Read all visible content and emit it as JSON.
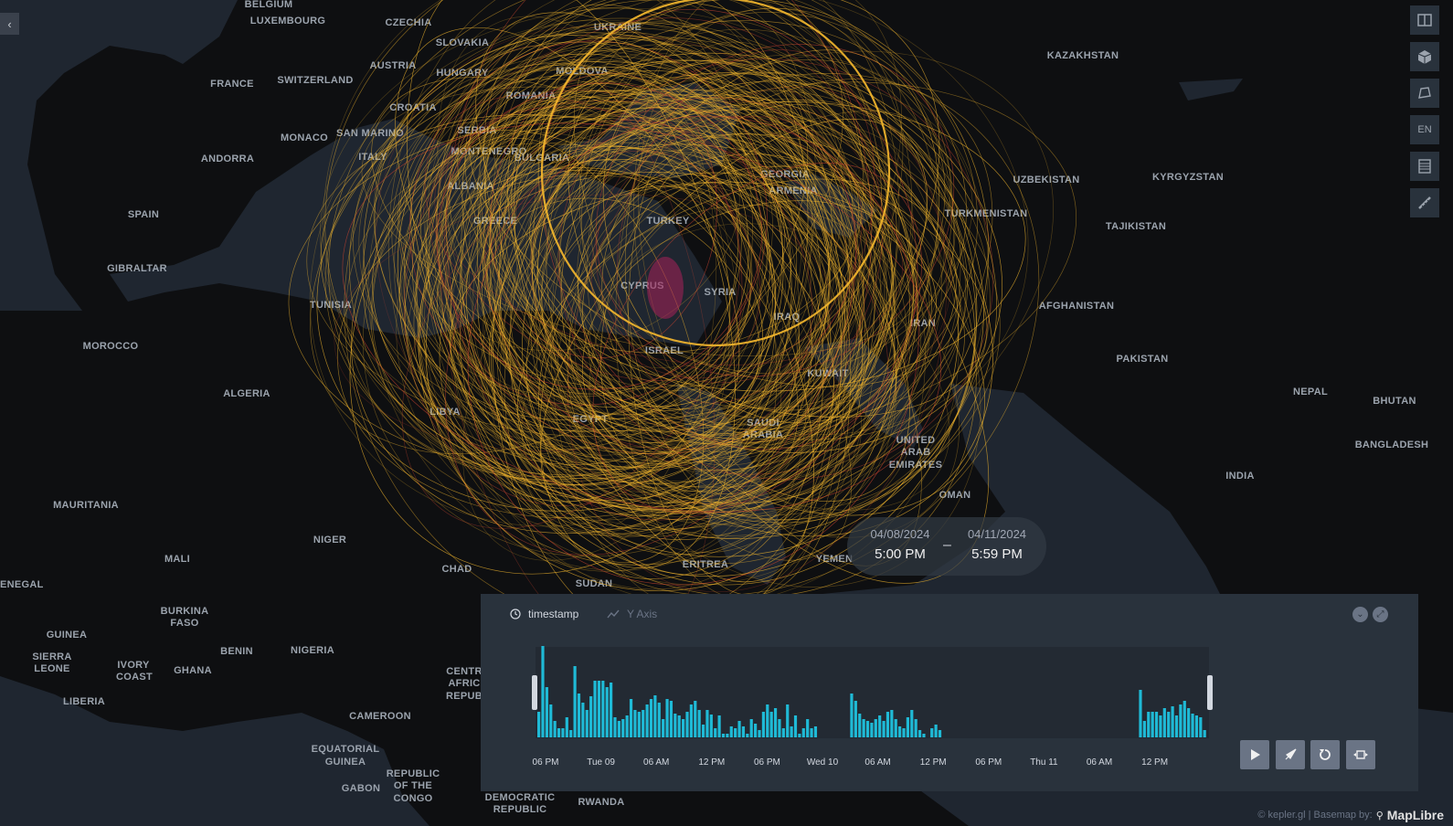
{
  "map": {
    "country_labels": [
      "BELGIUM",
      "LUXEMBOURG",
      "CZECHIA",
      "SLOVAKIA",
      "UKRAINE",
      "AUSTRIA",
      "HUNGARY",
      "MOLDOVA",
      "FRANCE",
      "SWITZERLAND",
      "ROMANIA",
      "CROATIA",
      "MONACO",
      "SAN MARINO",
      "SERBIA",
      "ANDORRA",
      "ITALY",
      "MONTENEGRO",
      "BULGARIA",
      "ALBANIA",
      "SPAIN",
      "GREECE",
      "TURKEY",
      "GEORGIA",
      "ARMENIA",
      "GIBRALTAR",
      "TUNISIA",
      "CYPRUS",
      "SYRIA",
      "IRAQ",
      "MOROCCO",
      "ISRAEL",
      "IRAN",
      "ALGERIA",
      "KUWAIT",
      "LIBYA",
      "EGYPT",
      "SAUDI",
      "ARABIA",
      "UNITED",
      "ARAB",
      "EMIRATES",
      "OMAN",
      "YEMEN",
      "ERITREA",
      "SUDAN",
      "CHAD",
      "NIGER",
      "MALI",
      "MAURITANIA",
      "SENEGAL",
      "BURKINA",
      "FASO",
      "GUINEA",
      "SIERRA",
      "LEONE",
      "IVORY",
      "COAST",
      "GHANA",
      "BENIN",
      "NIGERIA",
      "LIBERIA",
      "CAMEROON",
      "EQUATORIAL",
      "GUINEA",
      "GABON",
      "REPUBLIC",
      "OF THE",
      "CONGO",
      "DEMOCRATIC",
      "REPUBLIC",
      "RWANDA",
      "CENTR",
      "AFRIC",
      "REPUB",
      "KAZAKHSTAN",
      "UZBEKISTAN",
      "KYRGYZSTAN",
      "TURKMENISTAN",
      "TAJIKISTAN",
      "AFGHANISTAN",
      "PAKISTAN",
      "NEPAL",
      "BHUTAN",
      "BANGLADESH",
      "INDIA"
    ],
    "arc_color": "#f5b82e",
    "arc_color_inner": "#c4432f"
  },
  "toolbar": {
    "icons": [
      "split-map-icon",
      "layer-3d-icon",
      "draw-polygon-icon",
      "locale-icon",
      "data-table-icon",
      "ruler-icon"
    ],
    "locale_label": "EN"
  },
  "time_display": {
    "start_date": "04/08/2024",
    "start_time": "5:00 PM",
    "separator": "–",
    "end_date": "04/11/2024",
    "end_time": "5:59 PM"
  },
  "timeline": {
    "field_label": "timestamp",
    "y_axis_label": "Y Axis",
    "accent": "#1fbad6",
    "bars": [
      28,
      100,
      55,
      36,
      18,
      10,
      10,
      22,
      8,
      78,
      48,
      38,
      30,
      45,
      62,
      62,
      62,
      55,
      60,
      22,
      18,
      20,
      24,
      42,
      30,
      28,
      30,
      36,
      42,
      46,
      38,
      20,
      42,
      40,
      26,
      24,
      20,
      28,
      36,
      40,
      30,
      14,
      30,
      25,
      10,
      24,
      4,
      4,
      12,
      10,
      18,
      12,
      4,
      20,
      15,
      8,
      28,
      36,
      28,
      32,
      20,
      10,
      36,
      12,
      24,
      4,
      10,
      20,
      10,
      12,
      0,
      0,
      0,
      0,
      0,
      0,
      0,
      0,
      48,
      40,
      26,
      20,
      18,
      16,
      20,
      24,
      18,
      28,
      30,
      20,
      12,
      10,
      22,
      30,
      20,
      8,
      4,
      0,
      10,
      14,
      8,
      0,
      0,
      0,
      0,
      0,
      0,
      0,
      0,
      0,
      0,
      0,
      0,
      0,
      0,
      0,
      0,
      0,
      0,
      0,
      0,
      0,
      0,
      0,
      0,
      0,
      0,
      0,
      0,
      0,
      0,
      0,
      0,
      0,
      0,
      0,
      0,
      0,
      0,
      0,
      0,
      0,
      0,
      0,
      0,
      0,
      0,
      0,
      0,
      0,
      52,
      18,
      28,
      28,
      28,
      24,
      32,
      28,
      34,
      24,
      36,
      40,
      32,
      26,
      24,
      22,
      8
    ],
    "ticks": [
      "06 PM",
      "Tue 09",
      "06 AM",
      "12 PM",
      "06 PM",
      "Wed 10",
      "06 AM",
      "12 PM",
      "06 PM",
      "Thu 11",
      "06 AM",
      "12 PM"
    ]
  },
  "controls": {
    "icons": [
      "play-icon",
      "speed-icon",
      "loop-icon",
      "window-mode-icon"
    ]
  },
  "attribution": {
    "text": "© kepler.gl | Basemap by:",
    "logo_text": "MapLibre"
  }
}
